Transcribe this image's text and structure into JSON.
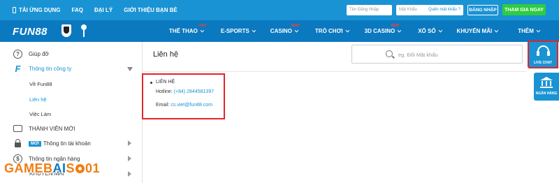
{
  "topbar": {
    "links": [
      "TẢI ỨNG DỤNG",
      "FAQ",
      "ĐẠI LÝ",
      "GIỚI THIỆU BẠN BÈ"
    ],
    "username_placeholder": "Tên Đăng Nhập",
    "password_placeholder": "Mật Khẩu",
    "forgot_label": "Quên mật khẩu ?",
    "login_label": "ĐĂNG NHẬP",
    "join_label": "THAM GIA NGAY"
  },
  "brand": {
    "logo": "FUN88"
  },
  "nav": {
    "items": [
      {
        "label": "THỂ THAO",
        "tag": "HOT"
      },
      {
        "label": "E-SPORTS",
        "tag": ""
      },
      {
        "label": "CASINO",
        "tag": "NEW"
      },
      {
        "label": "TRÒ CHƠI",
        "tag": ""
      },
      {
        "label": "3D CASINO",
        "tag": "NEW"
      },
      {
        "label": "XỔ SỐ",
        "tag": ""
      },
      {
        "label": "KHUYẾN MÃI",
        "tag": ""
      },
      {
        "label": "THÊM",
        "tag": ""
      }
    ]
  },
  "sidebar": {
    "help": "Giúp đỡ",
    "company": "Thông tin công ty",
    "sub_items": [
      "Về Fun88",
      "Liên hệ",
      "Việc Làm"
    ],
    "new_member": "THÀNH VIÊN MỚI",
    "account_badge": "MỚI",
    "account": "Thông tin tài khoản",
    "bank": "Thông tin ngân hàng",
    "promo": "KHUYẾN MÃI"
  },
  "watermark": {
    "part1": "GAMEB",
    "part2": "AI",
    "part3": "S",
    "part4": "01"
  },
  "main": {
    "title": "Liên hệ",
    "search_placeholder": "eg. Đổi Mật khẩu",
    "contact_heading": "LIÊN HỆ",
    "hotline_label": "Hotline: ",
    "hotline_value": "(+84) 2844581397",
    "email_label": "Email: ",
    "email_value": "cs.viet@fun88.com"
  },
  "widgets": {
    "live_chat": "LIVE CHAT",
    "bank": "NGÂN HÀNG"
  }
}
